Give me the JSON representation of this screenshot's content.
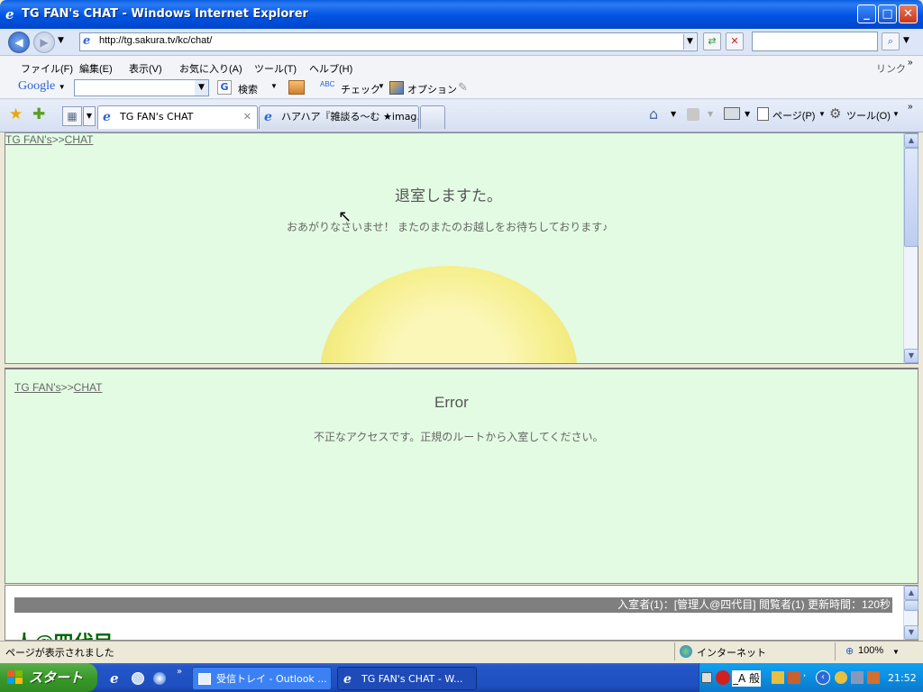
{
  "window": {
    "title": "TG FAN's CHAT - Windows Internet Explorer",
    "minimize": "_",
    "maximize": "□",
    "close": "✕"
  },
  "address": {
    "url": "http://tg.sakura.tv/kc/chat/"
  },
  "menu": [
    "ファイル(F)",
    "編集(E)",
    "表示(V)",
    "お気に入り(A)",
    "ツール(T)",
    "ヘルプ(H)"
  ],
  "links_label": "リンク",
  "google_toolbar": {
    "logo": "Google",
    "search_label": "検索",
    "check_label": "チェック",
    "options_label": "オプション"
  },
  "tabs": [
    {
      "label": "TG FAN's CHAT"
    },
    {
      "label": "ハアハア『雑談る〜む ★imag..."
    }
  ],
  "command_bar": {
    "page_label": "ページ(P)",
    "tools_label": "ツール(O)"
  },
  "frame1": {
    "crumb_site": "TG FAN's",
    "crumb_sep": ">>",
    "crumb_page": "CHAT",
    "heading": "退室しますた。",
    "message": "おあがりなさいませ！ またのまたのお越しをお待ちしております♪"
  },
  "frame2": {
    "crumb_site": "TG FAN's",
    "crumb_sep": ">>",
    "crumb_page": "CHAT",
    "heading": "Error",
    "message": "不正なアクセスです。正規のルートから入室してください。"
  },
  "frame3": {
    "info": "入室者(1)：[管理人@四代目] 閲覧者(1) 更新時間：120秒",
    "username": "人@四代目"
  },
  "status": {
    "text": "ページが表示されました",
    "zone": "インターネット",
    "zoom": "100%"
  },
  "taskbar": {
    "start": "スタート",
    "tasks": [
      {
        "label": "受信トレイ - Outlook ..."
      },
      {
        "label": "TG FAN's CHAT - W..."
      }
    ],
    "ime": "_A 般",
    "clock": "21:52"
  }
}
